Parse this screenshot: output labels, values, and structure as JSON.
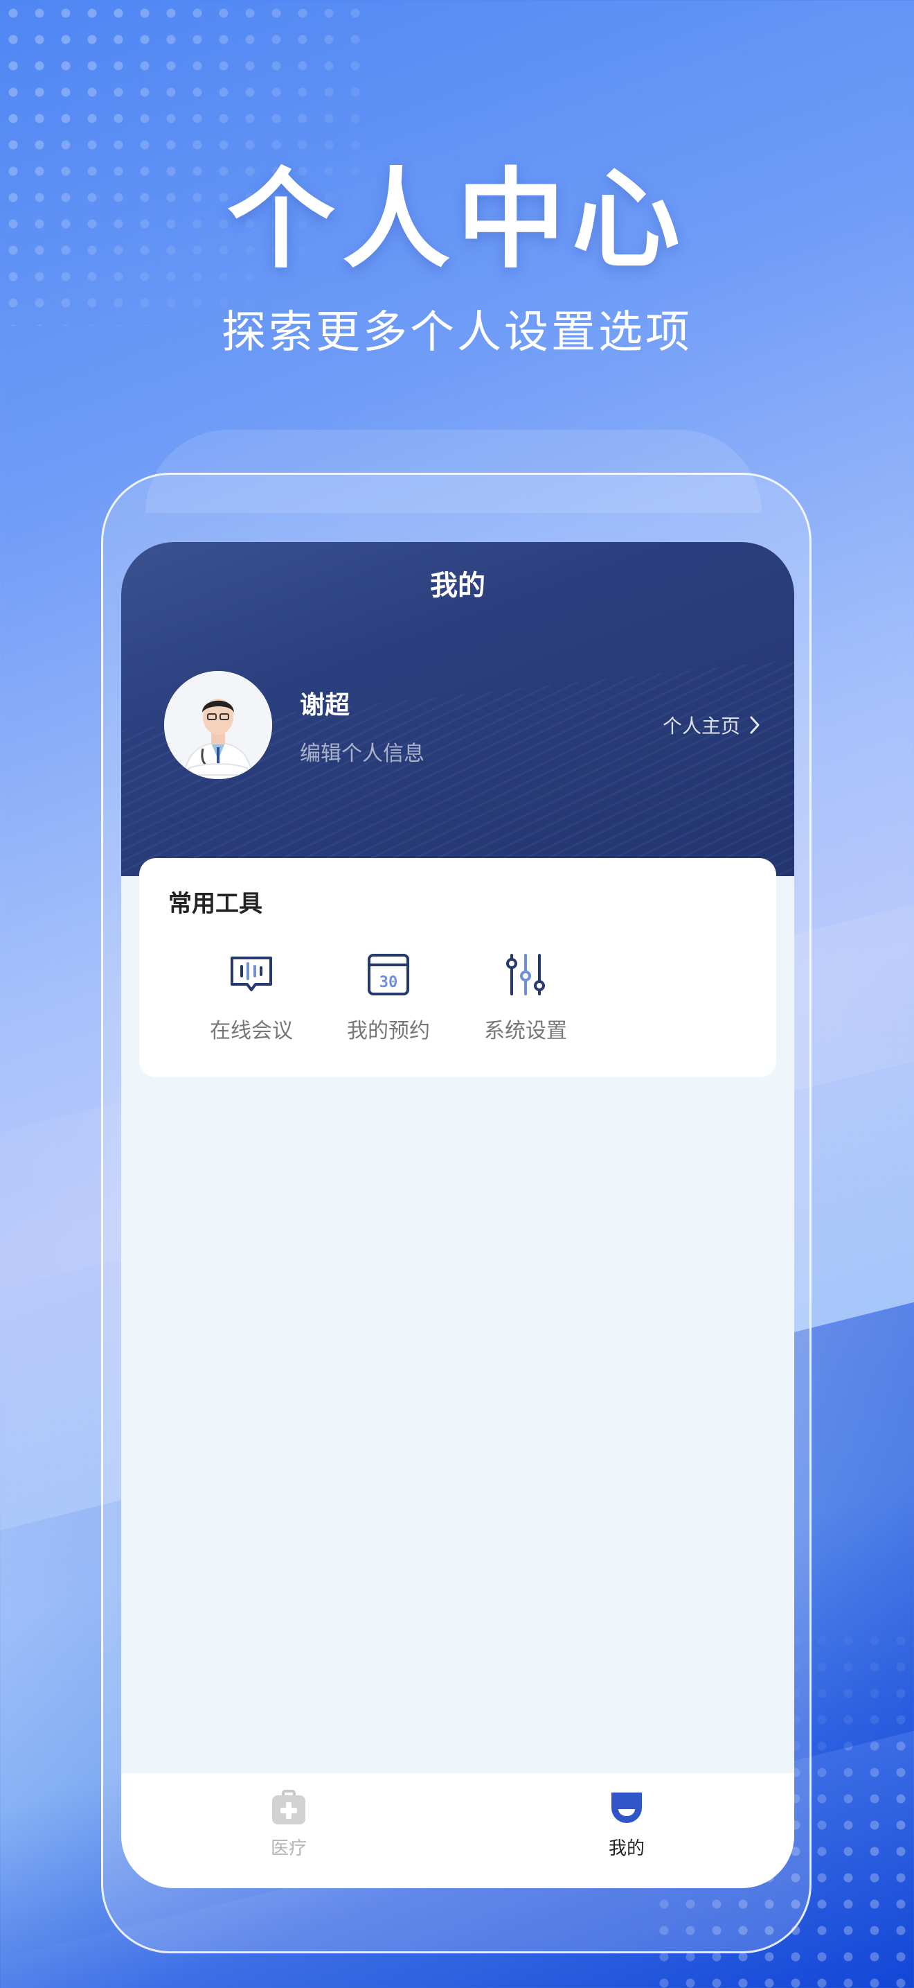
{
  "hero": {
    "title": "个人中心",
    "subtitle": "探索更多个人设置选项"
  },
  "nav": {
    "title": "我的"
  },
  "profile": {
    "name": "谢超",
    "edit_label": "编辑个人信息",
    "home_link": "个人主页"
  },
  "tools": {
    "title": "常用工具",
    "items": [
      {
        "label": "在线会议",
        "icon": "meeting-icon"
      },
      {
        "label": "我的预约",
        "icon": "calendar-icon",
        "icon_text": "30"
      },
      {
        "label": "系统设置",
        "icon": "settings-sliders-icon"
      }
    ]
  },
  "tabbar": {
    "items": [
      {
        "label": "医疗",
        "icon": "medical-kit-icon",
        "active": false
      },
      {
        "label": "我的",
        "icon": "profile-tab-icon",
        "active": true
      }
    ]
  },
  "colors": {
    "header": "#2b3f7e",
    "accent": "#2f55c8",
    "page_bg": "#eff6fb",
    "tab_inactive": "#c8c8c8"
  }
}
